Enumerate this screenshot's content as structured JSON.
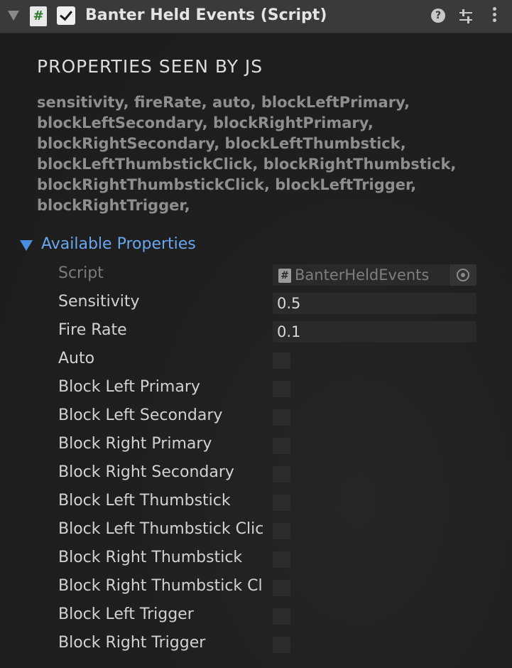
{
  "header": {
    "script_icon_glyph": "#",
    "title": "Banter Held Events (Script)",
    "enabled": true,
    "help_glyph": "?"
  },
  "properties_section": {
    "heading": "PROPERTIES SEEN BY JS",
    "list_text": "sensitivity, fireRate, auto, blockLeftPrimary, blockLeftSecondary, blockRightPrimary, blockRightSecondary, blockLeftThumbstick, blockLeftThumbstickClick, blockRightThumbstick, blockRightThumbstickClick, blockLeftTrigger, blockRightTrigger,"
  },
  "available": {
    "label": "Available Properties",
    "expanded": true,
    "script_field": {
      "label": "Script",
      "icon_glyph": "#",
      "value": "BanterHeldEvents"
    },
    "sensitivity": {
      "label": "Sensitivity",
      "value": "0.5"
    },
    "fire_rate": {
      "label": "Fire Rate",
      "value": "0.1"
    },
    "toggles": [
      {
        "label": "Auto",
        "checked": false
      },
      {
        "label": "Block Left Primary",
        "checked": false
      },
      {
        "label": "Block Left Secondary",
        "checked": false
      },
      {
        "label": "Block Right Primary",
        "checked": false
      },
      {
        "label": "Block Right Secondary",
        "checked": false
      },
      {
        "label": "Block Left Thumbstick",
        "checked": false
      },
      {
        "label": "Block Left Thumbstick Clic",
        "checked": false
      },
      {
        "label": "Block Right Thumbstick",
        "checked": false
      },
      {
        "label": "Block Right Thumbstick Cl",
        "checked": false
      },
      {
        "label": "Block Left Trigger",
        "checked": false
      },
      {
        "label": "Block Right Trigger",
        "checked": false
      }
    ]
  },
  "colors": {
    "header_bg": "#3a3a3a",
    "panel_bg": "#1e1e1e",
    "foldout_accent": "#6aa6f0",
    "script_hash_green": "#2b7a2b"
  }
}
